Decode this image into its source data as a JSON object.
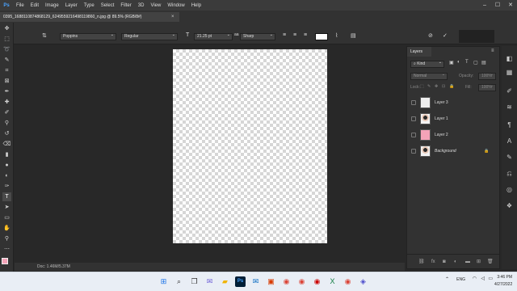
{
  "app": {
    "icon_label": "Ps"
  },
  "menu": [
    "File",
    "Edit",
    "Image",
    "Layer",
    "Type",
    "Select",
    "Filter",
    "3D",
    "View",
    "Window",
    "Help"
  ],
  "window_controls": [
    "–",
    "☐",
    "✕"
  ],
  "options": {
    "font_family": "Poppins",
    "font_style": "Regular",
    "font_size": "21.25 pt",
    "antialias": "Sharp"
  },
  "document_tab": "0395_168811087486812​9_624955921649811​9860_n.jpg @ 89.5% (RGB/8#)",
  "status": {
    "doc_size": "Doc: 1.46M/5.37M"
  },
  "layers_panel": {
    "tab": "Layers",
    "kind": "Kind",
    "blend": "Normal",
    "opacity_label": "Opacity:",
    "opacity_value": "100%",
    "lock_label": "Lock:",
    "fill_label": "Fill:",
    "fill_value": "100%",
    "layers": [
      {
        "name": "Layer 3",
        "thumb": "white",
        "italic": false
      },
      {
        "name": "Layer 1",
        "thumb": "photo",
        "italic": false
      },
      {
        "name": "Layer 2",
        "thumb": "pink",
        "italic": false
      },
      {
        "name": "Background",
        "thumb": "photo",
        "italic": true
      }
    ]
  },
  "colors": {
    "thumb_pink": "#f4a3b8",
    "thumb_white": "#eeeeee",
    "accent": "#4aa3ff"
  },
  "taskbar": {
    "lang": "ENG",
    "time": "3:46 PM",
    "date": "4/27/2022"
  }
}
